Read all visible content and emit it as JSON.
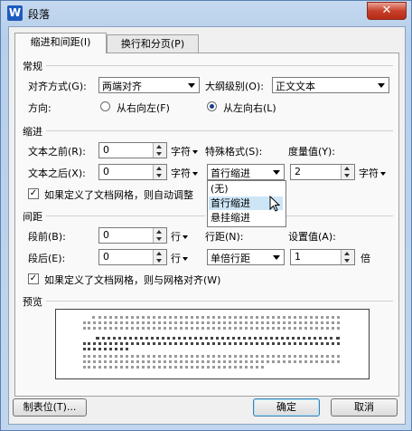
{
  "window": {
    "title": "段落",
    "close_glyph": "✕",
    "icon": "wps-writer-icon"
  },
  "tabs": [
    {
      "label": "缩进和间距(I)",
      "active": true
    },
    {
      "label": "换行和分页(P)",
      "active": false
    }
  ],
  "general": {
    "section_label": "常规",
    "alignment_label": "对齐方式(G):",
    "alignment_value": "两端对齐",
    "outline_label": "大纲级别(O):",
    "outline_value": "正文文本",
    "direction_label": "方向:",
    "rtl_label": "从右向左(F)",
    "ltr_label": "从左向右(L)"
  },
  "indent": {
    "section_label": "缩进",
    "before_label": "文本之前(R):",
    "before_value": "0",
    "before_unit": "字符",
    "after_label": "文本之后(X):",
    "after_value": "0",
    "after_unit": "字符",
    "special_label": "特殊格式(S):",
    "special_value": "首行缩进",
    "measure_label": "度量值(Y):",
    "measure_value": "2",
    "measure_unit": "字符",
    "grid_check_label": "如果定义了文档网格，则自动调整"
  },
  "special_dropdown": {
    "options": [
      "(无)",
      "首行缩进",
      "悬挂缩进"
    ],
    "selected": "首行缩进"
  },
  "spacing": {
    "section_label": "间距",
    "before_label": "段前(B):",
    "before_value": "0",
    "before_unit": "行",
    "after_label": "段后(E):",
    "after_value": "0",
    "after_unit": "行",
    "line_label": "行距(N):",
    "line_value": "单倍行距",
    "at_label": "设置值(A):",
    "at_value": "1",
    "at_unit": "倍",
    "grid_check_label": "如果定义了文档网格，则与网格对齐(W)"
  },
  "preview": {
    "section_label": "预览"
  },
  "buttons": {
    "tabs": "制表位(T)...",
    "ok": "确定",
    "cancel": "取消"
  },
  "colors": {
    "title_bar": "#b9d1ea",
    "close": "#c8412c",
    "selection": "#cde6f7"
  }
}
